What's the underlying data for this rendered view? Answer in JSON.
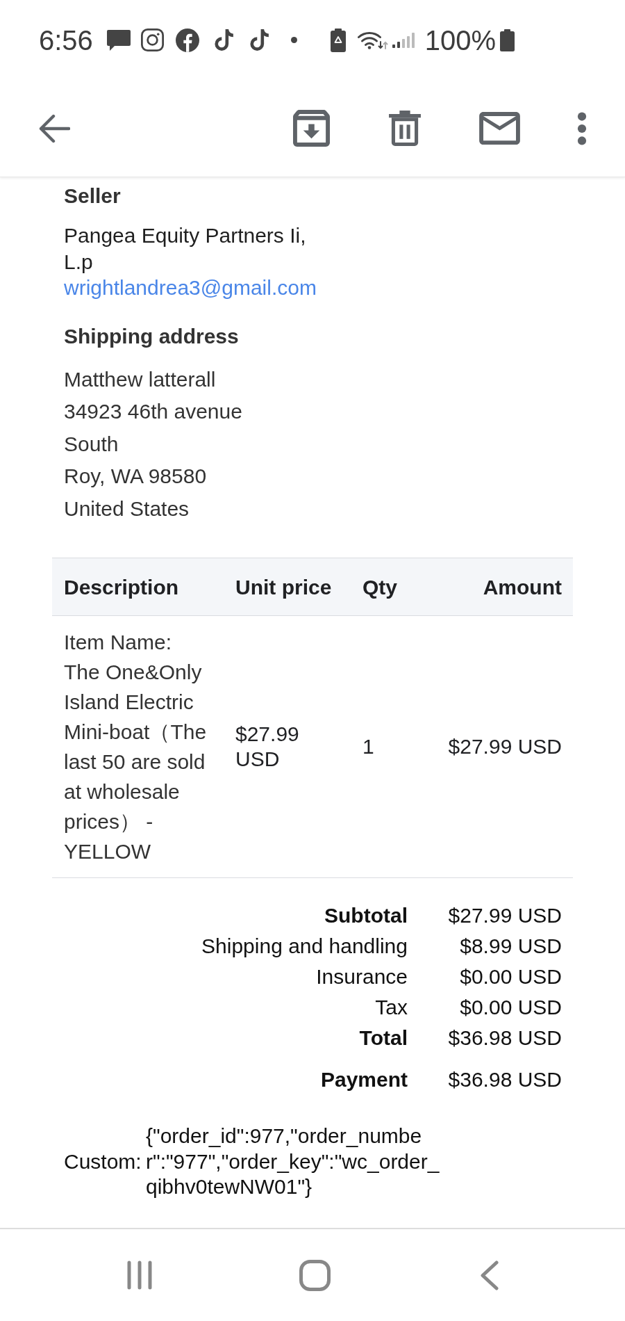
{
  "status_bar": {
    "time": "6:56",
    "battery": "100%"
  },
  "seller": {
    "heading": "Seller",
    "name": "Pangea Equity Partners Ii, L.p",
    "email": "wrightlandrea3@gmail.com"
  },
  "shipping_address": {
    "heading": "Shipping address",
    "lines": [
      "Matthew latterall",
      "34923 46th avenue",
      "South",
      "Roy, WA 98580",
      "United States"
    ]
  },
  "items_table": {
    "columns": [
      "Description",
      "Unit price",
      "Qty",
      "Amount"
    ],
    "rows": [
      {
        "description_label": "Item Name:",
        "description": "The One&Only Island Electric Mini-boat（The last 50 are sold at wholesale prices） - YELLOW",
        "unit_price": "$27.99 USD",
        "qty": "1",
        "amount": "$27.99 USD"
      }
    ]
  },
  "totals": [
    {
      "label": "Subtotal",
      "value": "$27.99 USD",
      "bold": true
    },
    {
      "label": "Shipping and handling",
      "value": "$8.99 USD",
      "bold": false
    },
    {
      "label": "Insurance",
      "value": "$0.00 USD",
      "bold": false
    },
    {
      "label": "Tax",
      "value": "$0.00 USD",
      "bold": false
    },
    {
      "label": "Total",
      "value": "$36.98 USD",
      "bold": true
    }
  ],
  "payment": {
    "label": "Payment",
    "value": "$36.98 USD"
  },
  "custom": {
    "label": "Custom:",
    "value": "{\"order_id\":977,\"order_number\":\"977\",\"order_key\":\"wc_order_qibhv0tewNW01\"}"
  }
}
